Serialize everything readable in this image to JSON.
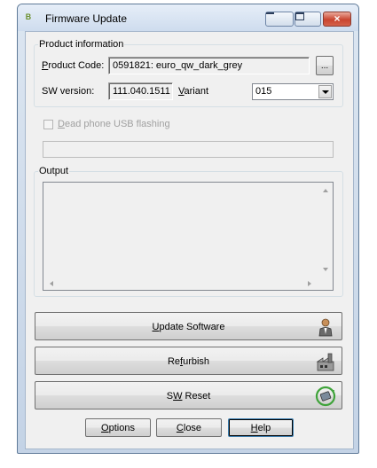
{
  "window": {
    "title": "Firmware Update",
    "controls": {
      "minimize": "minimize",
      "maximize": "maximize",
      "close": "×"
    }
  },
  "product_info": {
    "legend": "Product information",
    "product_code_label_u": "P",
    "product_code_label_rest": "roduct Code:",
    "product_code_value": "0591821: euro_qw_dark_grey",
    "browse_label": "...",
    "sw_version_label": "SW version:",
    "sw_version_value": "111.040.1511",
    "variant_label_u": "V",
    "variant_label_rest": "ariant",
    "variant_value": "015"
  },
  "dead_phone": {
    "label_u": "D",
    "label_rest": "ead phone USB flashing",
    "checked": false
  },
  "output": {
    "legend": "Output"
  },
  "actions": {
    "update_u": "U",
    "update_rest": "pdate Software",
    "refurbish_pre": "Re",
    "refurbish_u": "f",
    "refurbish_rest": "urbish",
    "reset_pre": "S",
    "reset_u": "W",
    "reset_rest": " Reset"
  },
  "footer": {
    "options_u": "O",
    "options_rest": "ptions",
    "close_u": "C",
    "close_rest": "lose",
    "help_u": "H",
    "help_rest": "elp"
  },
  "colors": {
    "accent_close": "#c9452f",
    "frame": "#c4d3e6",
    "face": "#f0f0f0"
  },
  "icons": [
    "firmware-app-icon",
    "person-icon",
    "factory-icon",
    "reset-chip-icon"
  ]
}
